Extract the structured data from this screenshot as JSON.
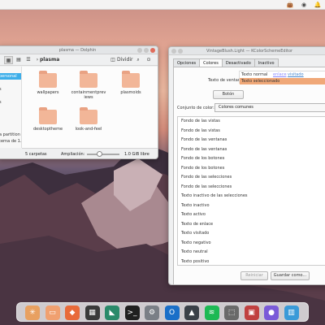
{
  "topbar": {
    "icons": [
      "bag-icon",
      "account-icon",
      "bell-icon"
    ]
  },
  "dolphin": {
    "title": "plasma — Dolphin",
    "breadcrumb": "plasma",
    "split_label": "Dividir",
    "sidebar_items": [
      "",
      "personal",
      "",
      "s",
      "",
      "s",
      "",
      "",
      "",
      "",
      "a partition",
      "terna de 1..."
    ],
    "folders": [
      {
        "name": "wallpapers"
      },
      {
        "name": "containmentpreviews"
      },
      {
        "name": "plasmoids"
      },
      {
        "name": "desktoptheme"
      },
      {
        "name": "look-and-feel"
      }
    ],
    "status_count": "5 carpetas",
    "zoom_label": "Ampliación:",
    "free_space": "1.0 GiB libre"
  },
  "editor": {
    "title": "VintageBlush.Light — KColorSchemeEditor",
    "tabs": [
      "Opciones",
      "Colores",
      "Desactivado",
      "Inactivo"
    ],
    "window_text_label": "Texto de ventana",
    "normal_text": "Texto normal",
    "link_text": "enlace",
    "visited_text": "visitado",
    "selected_text": "Texto seleccionado",
    "button_label": "Botón",
    "color_set_label": "Conjunto de color:",
    "color_set_value": "Colores comunes",
    "color_roles": [
      "Fondo de las vistas",
      "Fondo de las vistas",
      "Fondo de las ventanas",
      "Fondo de las ventanas",
      "Fondo de los botones",
      "Fondo de los botones",
      "Fondo de las selecciones",
      "Fondo de las selecciones",
      "Texto inactivo de las selecciones",
      "Texto inactivo",
      "Texto activo",
      "Texto de enlace",
      "Texto visitado",
      "Texto negativo",
      "Texto neutral",
      "Texto positivo"
    ],
    "reset_label": "Reiniciar",
    "save_as_label": "Guardar como..."
  },
  "dock": {
    "items": [
      {
        "name": "launcher-icon",
        "color": "#e8a060",
        "glyph": "✳"
      },
      {
        "name": "files-icon",
        "color": "#f0a070",
        "glyph": "▭"
      },
      {
        "name": "software-icon",
        "color": "#e86a3a",
        "glyph": "◆"
      },
      {
        "name": "apps-grid-icon",
        "color": "#3a3a3a",
        "glyph": "▦"
      },
      {
        "name": "photo-icon",
        "color": "#2a8a6a",
        "glyph": "◣"
      },
      {
        "name": "terminal-icon",
        "color": "#202020",
        "glyph": ">_"
      },
      {
        "name": "settings-icon",
        "color": "#7a7f86",
        "glyph": "⚙"
      },
      {
        "name": "outlook-icon",
        "color": "#1a6fc8",
        "glyph": "O"
      },
      {
        "name": "vpn-icon",
        "color": "#3a4048",
        "glyph": "▲"
      },
      {
        "name": "spotify-icon",
        "color": "#1db954",
        "glyph": "≋"
      },
      {
        "name": "screenshot-icon",
        "color": "#6a6a6a",
        "glyph": "⬚"
      },
      {
        "name": "store-icon",
        "color": "#c04040",
        "glyph": "▣"
      },
      {
        "name": "paint-icon",
        "color": "#7a5ad8",
        "glyph": "●"
      },
      {
        "name": "trash-icon",
        "color": "#3a9ad8",
        "glyph": "▥"
      }
    ]
  }
}
